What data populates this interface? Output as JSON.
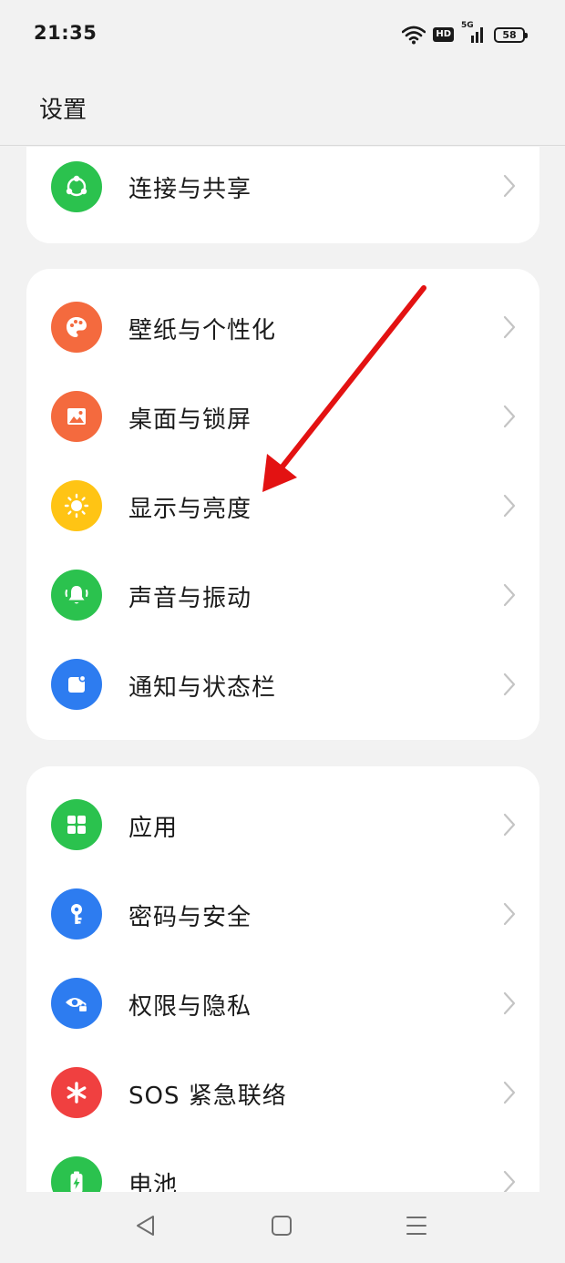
{
  "status_bar": {
    "time": "21:35",
    "hd_label": "HD",
    "network_label": "5G",
    "battery_level": "58"
  },
  "header": {
    "title": "设置"
  },
  "groups": [
    {
      "items": [
        {
          "label": "连接与共享",
          "icon": "share-icon",
          "color": "#2bc24e"
        }
      ]
    },
    {
      "items": [
        {
          "label": "壁纸与个性化",
          "icon": "palette-icon",
          "color": "#f46a3e"
        },
        {
          "label": "桌面与锁屏",
          "icon": "image-icon",
          "color": "#f46a3e"
        },
        {
          "label": "显示与亮度",
          "icon": "sun-icon",
          "color": "#ffc414"
        },
        {
          "label": "声音与振动",
          "icon": "bell-icon",
          "color": "#2bc24e"
        },
        {
          "label": "通知与状态栏",
          "icon": "notification-icon",
          "color": "#2d7cf0"
        }
      ]
    },
    {
      "items": [
        {
          "label": "应用",
          "icon": "apps-grid-icon",
          "color": "#2bc24e"
        },
        {
          "label": "密码与安全",
          "icon": "key-icon",
          "color": "#2d7cf0"
        },
        {
          "label": "权限与隐私",
          "icon": "eye-lock-icon",
          "color": "#2d7cf0"
        },
        {
          "label": "SOS 紧急联络",
          "icon": "asterisk-icon",
          "color": "#f04040"
        },
        {
          "label": "电池",
          "icon": "battery-icon",
          "color": "#2bc24e"
        }
      ]
    }
  ],
  "nav_bar": {
    "back_icon": "triangle-back-icon",
    "home_icon": "square-home-icon",
    "recents_icon": "menu-lines-icon"
  },
  "colors": {
    "background": "#f2f2f2",
    "card": "#ffffff",
    "chevron": "#c4c4c4",
    "annotation_arrow": "#e31212"
  }
}
